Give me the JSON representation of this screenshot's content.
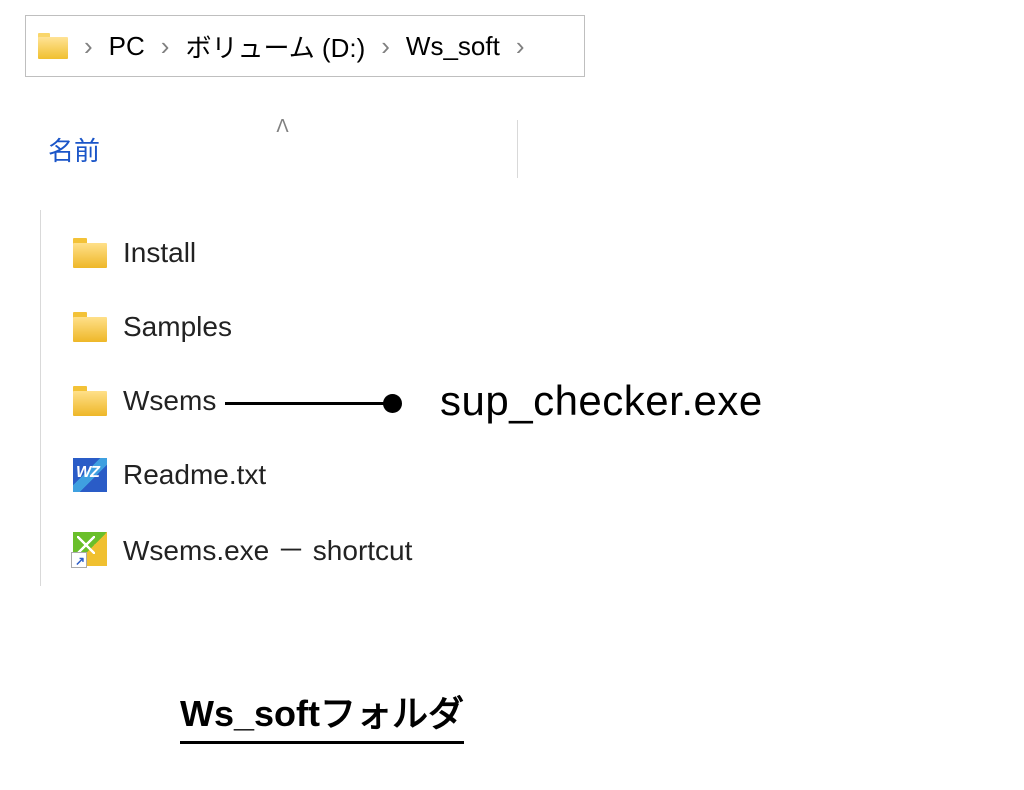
{
  "breadcrumb": {
    "items": [
      "PC",
      "ボリューム (D:)",
      "Ws_soft"
    ]
  },
  "column_header": {
    "name_label": "名前",
    "sort_indicator": "ᐱ"
  },
  "files": [
    {
      "name": "Install",
      "icon": "folder"
    },
    {
      "name": "Samples",
      "icon": "folder"
    },
    {
      "name": "Wsems",
      "icon": "folder"
    },
    {
      "name": "Readme.txt",
      "icon": "wz"
    },
    {
      "name": "Wsems.exe － shortcut",
      "icon": "shortcut"
    }
  ],
  "annotation": {
    "label": "sup_checker.exe"
  },
  "caption": "Ws_softフォルダ"
}
